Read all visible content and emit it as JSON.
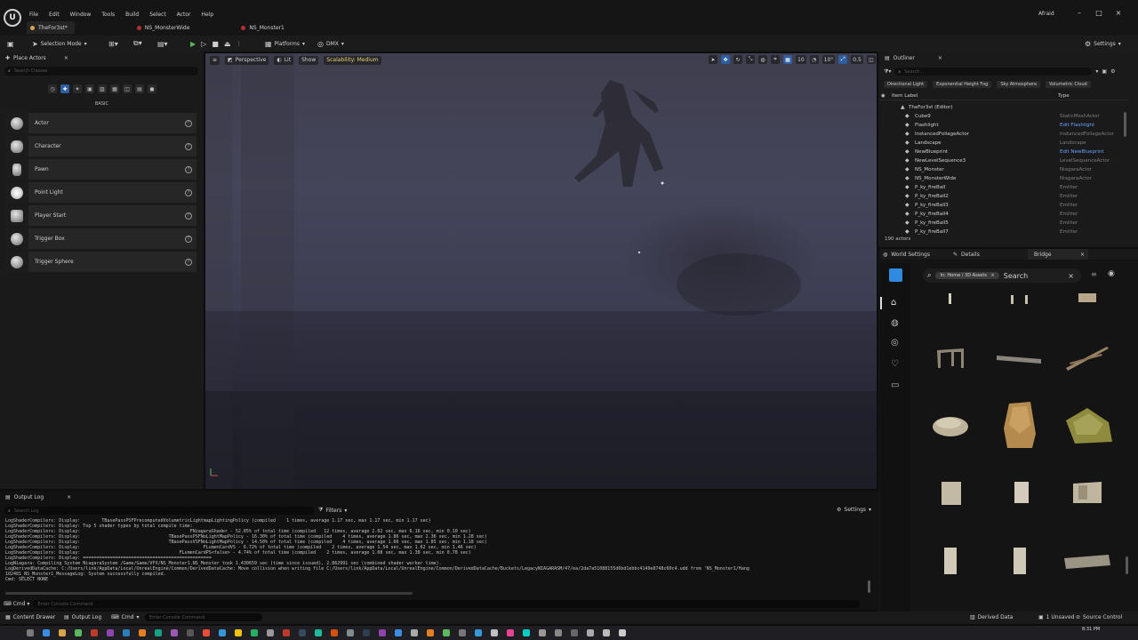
{
  "menu": [
    "File",
    "Edit",
    "Window",
    "Tools",
    "Build",
    "Select",
    "Actor",
    "Help"
  ],
  "doc_tabs": [
    {
      "label": "TheFor3st*",
      "color": "#d9a54a",
      "active": true
    },
    {
      "label": "NS_MonsterWide",
      "color": "#b7302f",
      "active": false
    },
    {
      "label": "NS_Monster1",
      "color": "#b7302f",
      "active": false
    }
  ],
  "profile_label": "Afraid",
  "toolbar": {
    "selection_mode": "Selection Mode",
    "platforms": "Platforms",
    "dmx": "DMX",
    "settings": "Settings"
  },
  "place_actors": {
    "title": "Place Actors",
    "search_placeholder": "Search Classes",
    "category": "BASIC",
    "items": [
      "Actor",
      "Character",
      "Pawn",
      "Point Light",
      "Player Start",
      "Trigger Box",
      "Trigger Sphere"
    ]
  },
  "viewport": {
    "perspective": "Perspective",
    "lit": "Lit",
    "show": "Show",
    "scalability": "Scalability: Medium",
    "grid_size": "10",
    "rot_snap": "10°",
    "scale_snap": "0.5",
    "cam_speed": "4"
  },
  "outliner": {
    "title": "Outliner",
    "search_placeholder": "Search...",
    "filters": [
      "Directional Light",
      "Exponential Height Fog",
      "Sky Atmosphere",
      "Volumetric Cloud"
    ],
    "col_label": "Item Label",
    "col_type": "Type",
    "root": "TheFor3st (Editor)",
    "rows": [
      {
        "name": "Cube9",
        "type": "StaticMeshActor",
        "link": false
      },
      {
        "name": "Flashlight",
        "type": "Edit Flashlight",
        "link": true
      },
      {
        "name": "InstancedFoliageActor",
        "type": "InstancedFoliageActor",
        "link": false
      },
      {
        "name": "Landscape",
        "type": "Landscape",
        "link": false
      },
      {
        "name": "NewBlueprint",
        "type": "Edit NewBlueprint",
        "link": true
      },
      {
        "name": "NewLevelSequence3",
        "type": "LevelSequenceActor",
        "link": false
      },
      {
        "name": "NS_Monster",
        "type": "NiagaraActor",
        "link": false
      },
      {
        "name": "NS_MonsterWide",
        "type": "NiagaraActor",
        "link": false
      },
      {
        "name": "P_ky_fireBall",
        "type": "Emitter",
        "link": false
      },
      {
        "name": "P_ky_fireBall2",
        "type": "Emitter",
        "link": false
      },
      {
        "name": "P_ky_fireBall3",
        "type": "Emitter",
        "link": false
      },
      {
        "name": "P_ky_fireBall4",
        "type": "Emitter",
        "link": false
      },
      {
        "name": "P_ky_fireBall5",
        "type": "Emitter",
        "link": false
      },
      {
        "name": "P_ky_fireBall7",
        "type": "Emitter",
        "link": false
      }
    ],
    "count": "190 actors"
  },
  "details_tabs": {
    "world_settings": "World Settings",
    "details": "Details",
    "bridge": "Bridge"
  },
  "bridge": {
    "breadcrumb": "In: Home / 3D Assets",
    "search": "Search"
  },
  "output_log": {
    "title": "Output Log",
    "search_placeholder": "Search Log",
    "filters": "Filters",
    "settings": "Settings",
    "lines": [
      "LogShaderCompilers: Display:        TBasePassPSFPrecomputedVolumetricLightmapLightingPolicy (compiled    1 times, average 1.17 sec, max 1.17 sec, min 1.17 sec)",
      "LogShaderCompilers: Display: Top 5 shader types by total compile time:",
      "LogShaderCompilers: Display:                                         FNiagaraShader - 52.85% of total time (compiled   12 times, average 2.02 sec, max 6.16 sec, min 0.10 sec)",
      "LogShaderCompilers: Display:                                 TBasePassPSFNoLightMapPolicy - 16.30% of total time (compiled    4 times, average 1.86 sec, max 2.36 sec, min 1.28 sec)",
      "LogShaderCompilers: Display:                                 TBasePassVSFNoLightMapPolicy - 14.50% of total time (compiled    4 times, average 1.66 sec, max 1.85 sec, min 1.18 sec)",
      "LogShaderCompilers: Display:                                              FLumenCardVS - 6.72% of total time (compiled    2 times, average 1.54 sec, max 1.62 sec, min 1.46 sec)",
      "LogShaderCompilers: Display:                                     FLumenCardPS<false> - 4.74% of total time (compiled    2 times, average 1.08 sec, max 1.38 sec, min 0.78 sec)",
      "LogShaderCompilers: Display: ================================================",
      "LogNiagara: Compiling System NiagaraSystem /Game/Game/VFX/NS_Monster1.NS_Monster took 1.430659 sec (time since issued), 2.862991 sec (combined shader worker time).",
      "LogDerivedDataCache: C:/Users/link/AppData/Local/UnrealEngine/Common/DerivedDataCache: Move collision when writing file C:/Users/link/AppData/Local/UnrealEngine/Common/DerivedDataCache/Buckets/LegacyNIAGARASM/47/ea/2da7a51088155d6bd1ebbc4149e8748c60c4.udd from 'NS_Monster1/Hang",
      "102481_NS_Monster1_MessageLog: System successfully compiled.",
      "Cmd: SELECT NONE"
    ],
    "cmd_label": "Cmd",
    "cmd_placeholder": "Enter Console Command"
  },
  "statusbar": {
    "content_drawer": "Content Drawer",
    "output_log": "Output Log",
    "cmd": "Cmd",
    "cmd_placeholder": "Enter Console Command",
    "derived_data": "Derived Data",
    "unsaved": "1 Unsaved",
    "source_control": "Source Control"
  },
  "clock": "8:31 PM",
  "accent": "#2c5ea0"
}
